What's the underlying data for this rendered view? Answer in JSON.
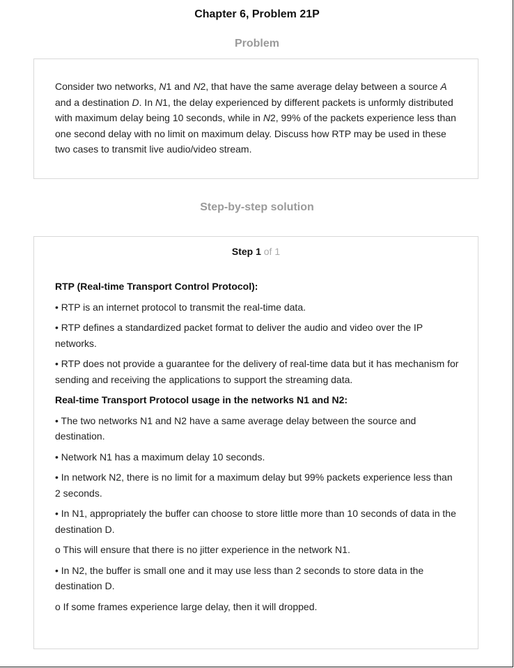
{
  "header": {
    "title": "Chapter 6, Problem 21P"
  },
  "problem": {
    "heading": "Problem",
    "text_parts": [
      "Consider two networks, ",
      "N",
      "1 and ",
      "N",
      "2, that have the same average delay between a source ",
      "A",
      " and a destination ",
      "D",
      ". In ",
      "N",
      "1, the delay experienced by different packets is unformly distributed with maximum delay being 10 seconds, while in ",
      "N",
      "2, 99% of the packets experience less than one second delay with no limit on maximum delay. Discuss how RTP may be used in these two cases to transmit live audio/video stream."
    ]
  },
  "solution": {
    "heading": "Step-by-step solution",
    "step_label": "Step 1",
    "step_of": " of 1",
    "heading1": "RTP (Real-time Transport Control Protocol):",
    "section1": [
      "• RTP is an internet protocol to transmit the real-time data.",
      "• RTP defines a standardized packet format to deliver the audio and video over the IP networks.",
      "• RTP does not provide a guarantee for the delivery of real-time data but it has mechanism for sending and receiving the applications to support the streaming data."
    ],
    "heading2": "Real-time Transport Protocol usage in the networks N1 and N2:",
    "section2": [
      "• The two networks N1 and N2 have a same average delay between the source and destination.",
      "• Network N1 has a maximum delay 10 seconds.",
      "• In network N2, there is no limit for a maximum delay but 99% packets experience less than 2 seconds.",
      "• In N1, appropriately the buffer can choose to store little more than 10 seconds of data in the destination D.",
      "o This will ensure that there is no jitter experience in the network N1.",
      "• In N2, the buffer is small one and it may use less than 2 seconds to store data in the destination D.",
      "o If some frames experience large delay, then it will dropped."
    ]
  }
}
